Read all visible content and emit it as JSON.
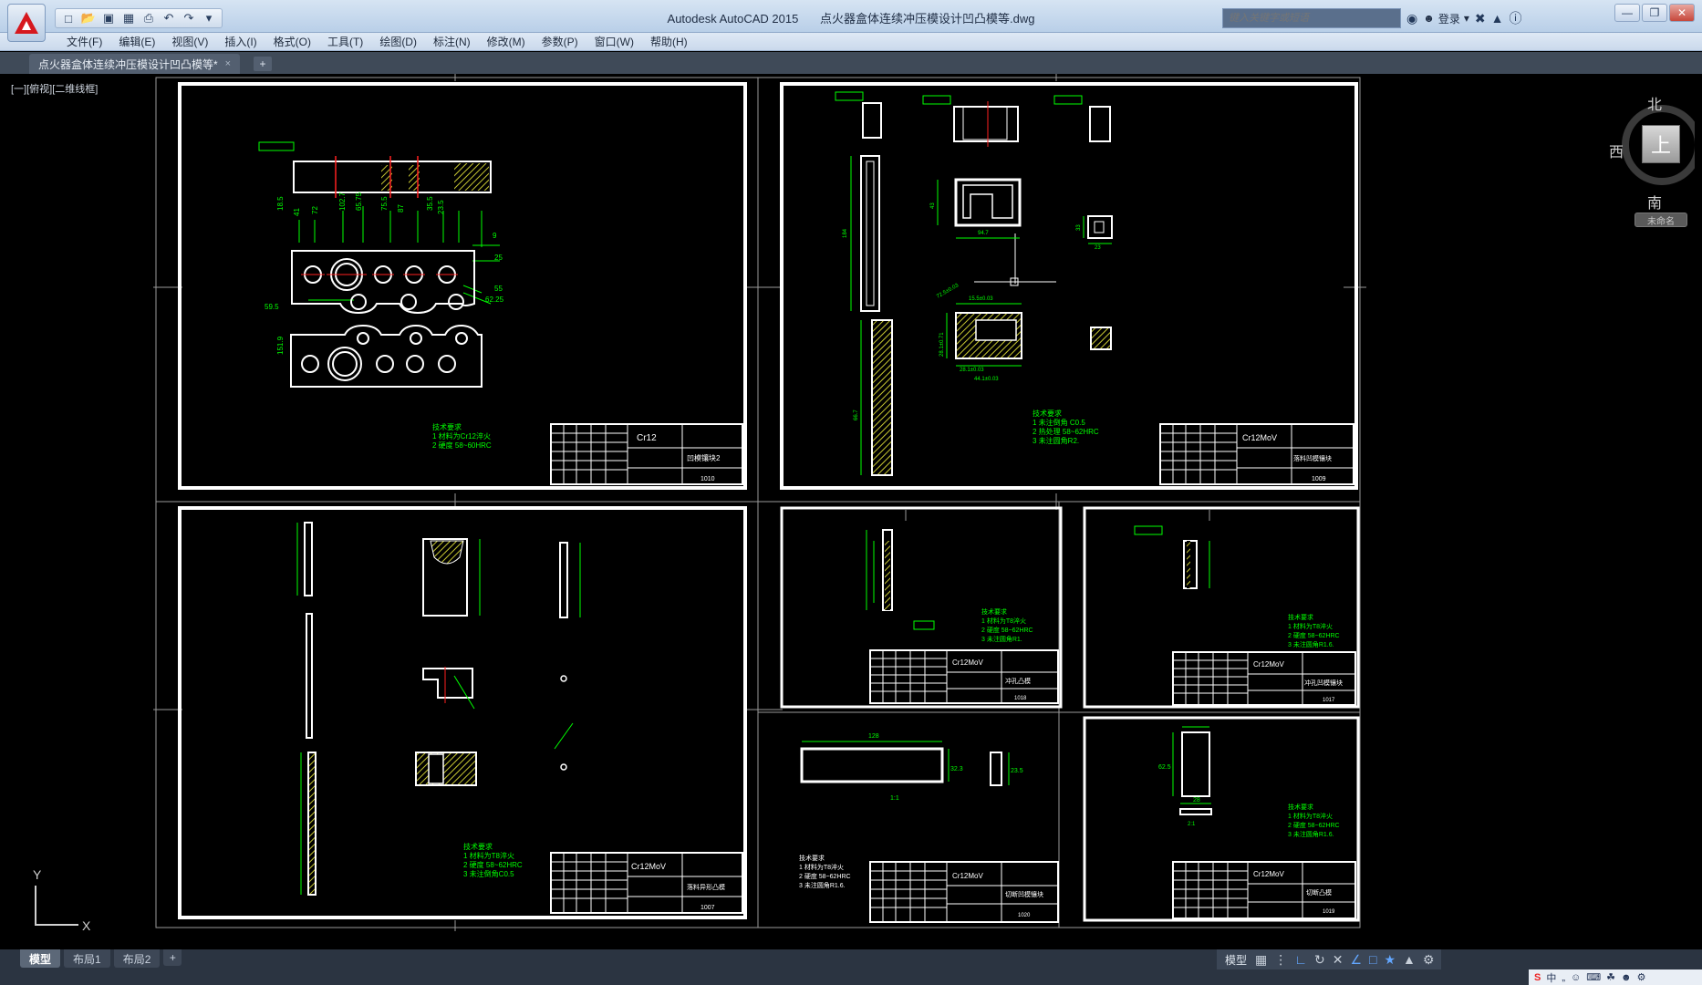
{
  "app": {
    "title": "Autodesk AutoCAD 2015",
    "filename": "点火器盒体连续冲压模设计凹凸模等.dwg",
    "search_placeholder": "键入关键字或短语",
    "login_label": "登录"
  },
  "menu": [
    "文件(F)",
    "编辑(E)",
    "视图(V)",
    "插入(I)",
    "格式(O)",
    "工具(T)",
    "绘图(D)",
    "标注(N)",
    "修改(M)",
    "参数(P)",
    "窗口(W)",
    "帮助(H)"
  ],
  "file_tab": {
    "label": "点火器盒体连续冲压模设计凹凸模等*",
    "close": "×",
    "new": "+"
  },
  "viewport_label": "[一][俯视][二维线框]",
  "viewcube": {
    "north": "北",
    "south": "南",
    "west": "西",
    "face": "上",
    "wcs": "未命名"
  },
  "ucs": {
    "x": "X",
    "y": "Y"
  },
  "layout_tabs": [
    "模型",
    "布局1",
    "布局2"
  ],
  "layout_add": "+",
  "status": {
    "model": "模型"
  },
  "ime": {
    "s": "S",
    "zh": "中"
  },
  "sheets": [
    {
      "id": "s1",
      "material": "Cr12",
      "name": "凹模镶块2",
      "code": "1010",
      "notes": [
        "技术要求",
        "1  材料为Cr12淬火",
        "2  硬度 58~60HRC"
      ]
    },
    {
      "id": "s2",
      "material": "Cr12MoV",
      "name": "落料凹模镶块",
      "code": "1009",
      "notes": [
        "技术要求",
        "1  未注倒角 C0.5",
        "2  热处理 58~62HRC",
        "3  未注圆角R2."
      ]
    },
    {
      "id": "s3",
      "material": "Cr12MoV",
      "name": "落料异形凸模",
      "code": "1007",
      "notes": [
        "技术要求",
        "1  材料为T8淬火",
        "2  硬度 58~62HRC",
        "3  未注倒角C0.5"
      ]
    },
    {
      "id": "s4",
      "material": "Cr12MoV",
      "name": "冲孔凸模",
      "code": "1018",
      "notes": [
        "技术要求",
        "1  材料为T8淬火",
        "2  硬度 58~62HRC",
        "3  未注圆角R1."
      ]
    },
    {
      "id": "s5",
      "material": "Cr12MoV",
      "name": "冲孔凹模镶块",
      "code": "1017",
      "notes": [
        "技术要求",
        "1  材料为T8淬火",
        "2  硬度 58~62HRC",
        "3  未注圆角R1.6."
      ]
    },
    {
      "id": "s6",
      "material": "Cr12MoV",
      "name": "切断凹模镶块",
      "code": "1020",
      "notes": [
        "技术要求",
        "1  材料为T8淬火",
        "2  硬度 58~62HRC",
        "3  未注圆角R1.6."
      ]
    },
    {
      "id": "s7",
      "material": "Cr12MoV",
      "name": "切断凸模",
      "code": "1019",
      "notes": [
        "技术要求",
        "1  材料为T8淬火",
        "2  硬度 58~62HRC",
        "3  未注圆角R1.6."
      ]
    }
  ],
  "dims": {
    "s1": [
      "18.5",
      "41",
      "72",
      "102.7",
      "65.75",
      "75.5",
      "87",
      "35.5",
      "23.5",
      "9",
      "25",
      "59.5",
      "55",
      "62.25",
      "151.9"
    ],
    "s2": [
      "184",
      "43",
      "94.7",
      "33",
      "23",
      "15.5±0.03",
      "28.1±0.03",
      "28.1±0.71",
      "44.1±0.03",
      "72.5±0.03",
      "66.7"
    ],
    "s6": [
      "128",
      "32.3",
      "23.5",
      "1:1"
    ],
    "s7": [
      "62.5",
      "28",
      "2:1"
    ]
  },
  "colors": {
    "geometry": "#ffffff",
    "dimension": "#00ff00",
    "hatch": "#c8c832",
    "center": "#ff2020",
    "frame": "#ffffff"
  }
}
